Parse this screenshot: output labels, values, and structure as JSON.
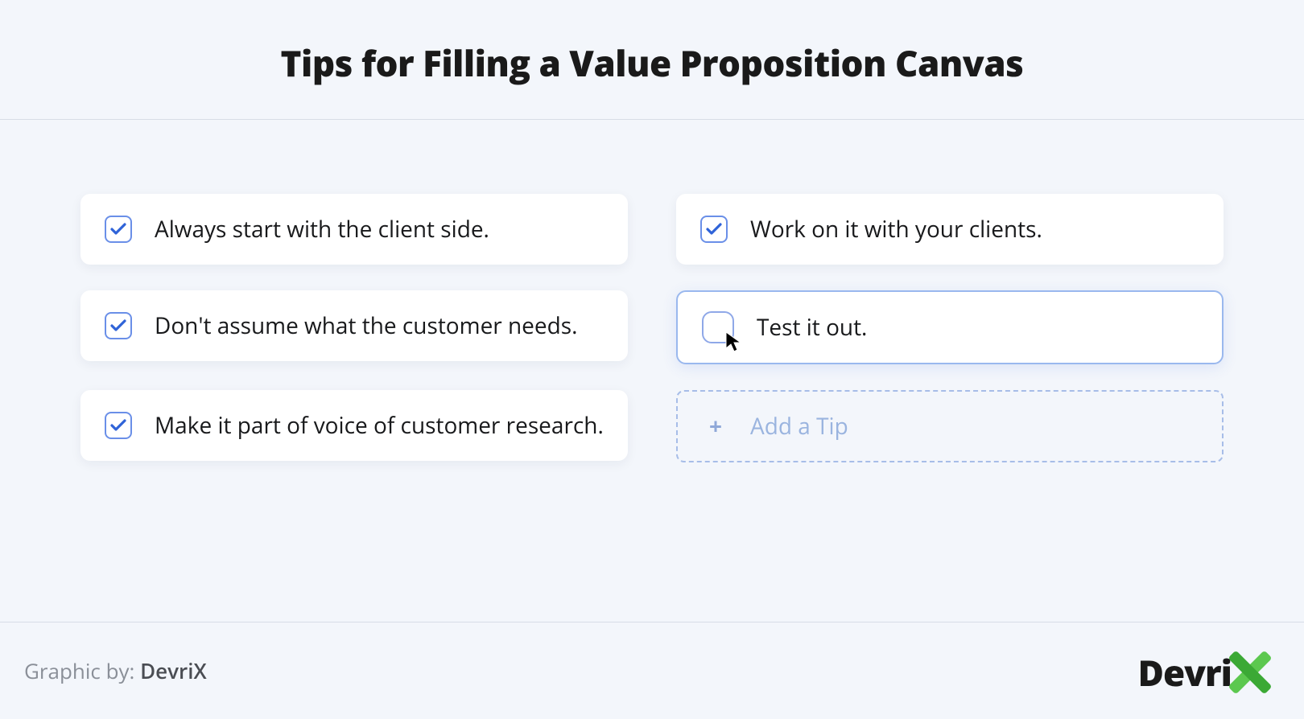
{
  "title": "Tips for Filling a Value Proposition Canvas",
  "tips": {
    "left": [
      {
        "text": "Always start with the client side.",
        "checked": true,
        "active": false
      },
      {
        "text": "Don't assume what the customer needs.",
        "checked": true,
        "active": false
      },
      {
        "text": "Make it part of voice of customer research.",
        "checked": true,
        "active": false
      }
    ],
    "right": [
      {
        "text": "Work on it with your clients.",
        "checked": true,
        "active": false
      },
      {
        "text": "Test it out.",
        "checked": false,
        "active": true
      }
    ]
  },
  "add_tip_label": "Add a Tip",
  "footer": {
    "prefix": "Graphic by: ",
    "brand": "DevriX"
  },
  "logo_text": "Devri"
}
